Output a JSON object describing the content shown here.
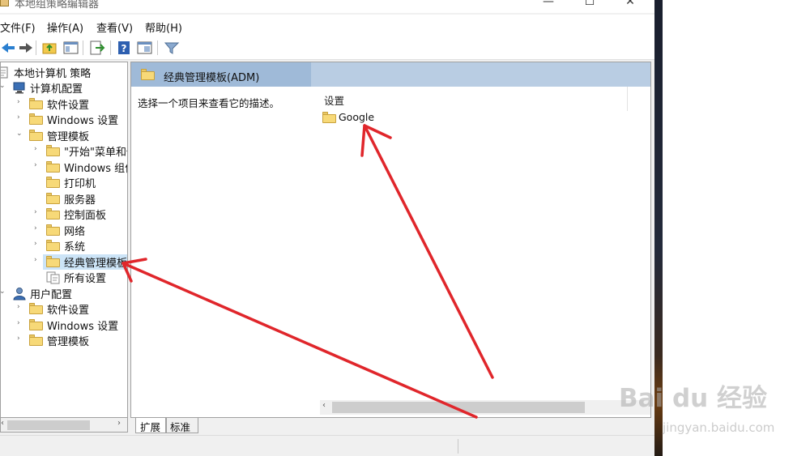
{
  "window": {
    "title": "本地组策略编辑器",
    "buttons": {
      "minimize": "—",
      "maximize": "☐",
      "close": "✕"
    }
  },
  "menu": [
    "文件(F)",
    "操作(A)",
    "查看(V)",
    "帮助(H)"
  ],
  "toolbar_icons": [
    "back-icon",
    "forward-icon",
    "up-folder-icon",
    "show-hide-tree-icon",
    "export-list-icon",
    "help-icon",
    "properties-icon",
    "filter-icon"
  ],
  "tree": {
    "root": "本地计算机 策略",
    "computer_config": "计算机配置",
    "software_settings": "软件设置",
    "windows_settings": "Windows 设置",
    "admin_templates": "管理模板",
    "start_menu": "\"开始\"菜单和任务栏",
    "windows_components": "Windows 组件",
    "printers": "打印机",
    "server": "服务器",
    "control_panel": "控制面板",
    "network": "网络",
    "system": "系统",
    "classic_admin": "经典管理模板",
    "all_settings": "所有设置",
    "user_config": "用户配置",
    "user_software": "软件设置",
    "user_windows": "Windows 设置",
    "user_admin": "管理模板"
  },
  "detail": {
    "header": "经典管理模板(ADM)",
    "description": "选择一个项目来查看它的描述。",
    "column_header": "设置",
    "items": [
      "Google"
    ]
  },
  "tabs": {
    "extended": "扩展",
    "standard": "标准"
  },
  "watermark": {
    "logo": "Bai du 经验",
    "url": "jingyan.baidu.com"
  },
  "colors": {
    "annotation_arrow": "#e0262b",
    "header_band": "#b9cde3",
    "folder": "#f7d978"
  }
}
